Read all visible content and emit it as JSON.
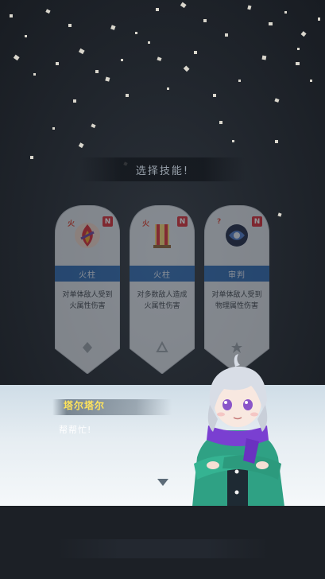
{
  "prompt": {
    "text": "选择技能!"
  },
  "cards": [
    {
      "name": "火柱",
      "rarity": "N",
      "tag": "火",
      "description": "对单体敌人受到火属性伤害",
      "icon": "fire-pillar-icon"
    },
    {
      "name": "火柱",
      "rarity": "N",
      "tag": "火",
      "description": "对多数敌人造成火属性伤害",
      "icon": "fire-pillar-icon"
    },
    {
      "name": "审判",
      "rarity": "N",
      "tag": "?",
      "description": "对单体敌人受到物理属性伤害",
      "icon": "judgement-icon"
    }
  ],
  "dialog": {
    "speaker": "塔尔塔尔",
    "line": "帮帮忙!",
    "next_icon": "triangle-down-icon"
  },
  "colors": {
    "speaker_name": "#ffe45c",
    "card_name_bar": "#2a67b0",
    "rarity_badge": "#d8262f",
    "scarf": "#7a3fd1",
    "coat": "#2fa184"
  }
}
